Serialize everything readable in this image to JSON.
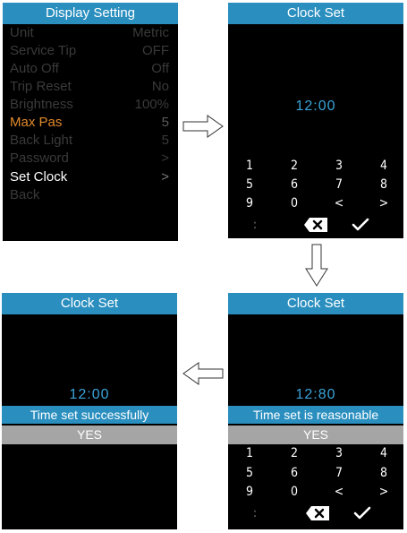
{
  "display_setting": {
    "title": "Display Setting",
    "items": [
      {
        "label": "Unit",
        "value": "Metric"
      },
      {
        "label": "Service Tip",
        "value": "OFF"
      },
      {
        "label": "Auto Off",
        "value": "Off"
      },
      {
        "label": "Trip Reset",
        "value": "No"
      },
      {
        "label": "Brightness",
        "value": "100%"
      },
      {
        "label": "Max Pas",
        "value": "5"
      },
      {
        "label": "Back Light",
        "value": "5"
      },
      {
        "label": "Password",
        "value": ">"
      },
      {
        "label": "Set Clock",
        "value": ">"
      },
      {
        "label": "Back",
        "value": ""
      }
    ]
  },
  "clock_set_1": {
    "title": "Clock Set",
    "time": "12:00"
  },
  "clock_set_2": {
    "title": "Clock Set",
    "time": "12:80",
    "message": "Time set is reasonable",
    "confirm": "YES"
  },
  "clock_set_3": {
    "title": "Clock Set",
    "time": "12:00",
    "message": "Time set successfully",
    "confirm": "YES"
  },
  "keypad": {
    "rows": [
      [
        "1",
        "2",
        "3",
        "4"
      ],
      [
        "5",
        "6",
        "7",
        "8"
      ],
      [
        "9",
        "0",
        "<",
        ">"
      ]
    ],
    "colon": ":",
    "delete_icon": "backspace-x-icon",
    "confirm_icon": "checkmark-icon"
  },
  "colors": {
    "title_bar": "#2a8fbf",
    "highlight": "#e08a2c",
    "time_text": "#3aa4d8",
    "yes_bar": "#a5a5a5"
  }
}
